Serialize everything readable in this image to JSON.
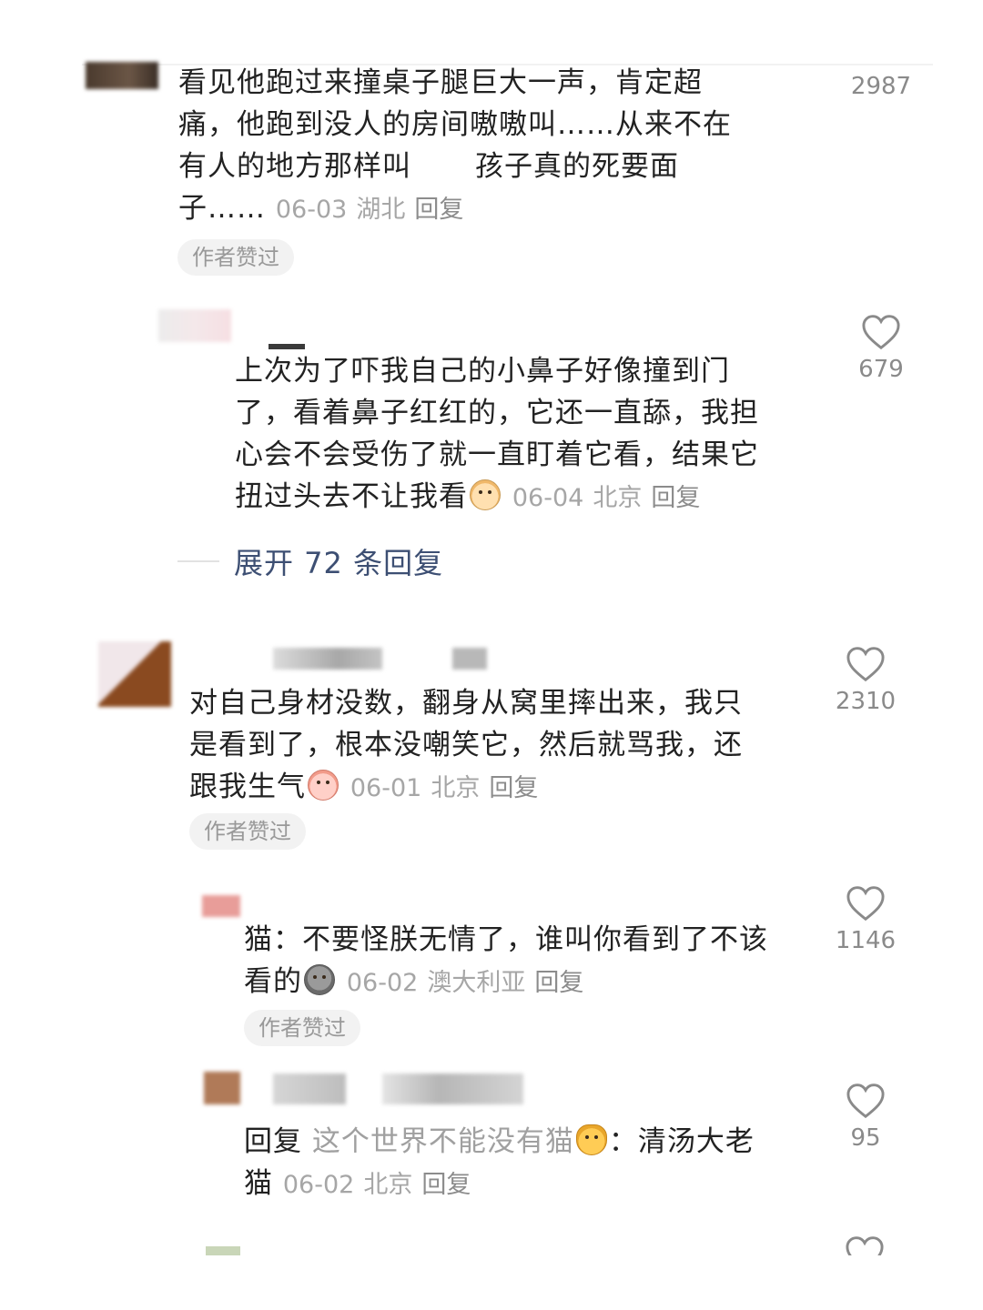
{
  "comments": [
    {
      "text": "看见他跑过来撞桌子腿巨大一声，肯定超痛，他跑到没人的房间嗷嗷叫……从来不在有人的地方那样叫",
      "text_line1": "看见他跑过来撞桌子腿巨大一声，肯定超",
      "text_line2": "痛，他跑到没人的房间嗷嗷叫……从来不在",
      "text_line3a": "有人的地方那样叫",
      "text_line3b": "孩子真的死要面",
      "text_line4": "子……",
      "date": "06-03",
      "region": "湖北",
      "reply_label": "回复",
      "likes": "2987",
      "author_liked": "作者赞过"
    },
    {
      "text_line1": "上次为了吓我自己的小鼻子好像撞到门",
      "text_line2": "了，看着鼻子红红的，它还一直舔，我担",
      "text_line3": "心会不会受伤了就一直盯着它看，结果它",
      "text_line4": "扭过头去不让我看",
      "emoji": "crying-face-emoji",
      "date": "06-04",
      "region": "北京",
      "reply_label": "回复",
      "likes": "679"
    },
    {
      "text_line1": "对自己身材没数，翻身从窝里摔出来，我只",
      "text_line2": "是看到了，根本没嘲笑它，然后就骂我，还",
      "text_line3": "跟我生气",
      "emoji": "angry-face-emoji",
      "date": "06-01",
      "region": "北京",
      "reply_label": "回复",
      "likes": "2310",
      "author_liked": "作者赞过"
    },
    {
      "text_line1": "猫：不要怪朕无情了，谁叫你看到了不该",
      "text_line2": "看的",
      "emoji": "skull-emoji",
      "date": "06-02",
      "region": "澳大利亚",
      "reply_label": "回复",
      "likes": "1146",
      "author_liked": "作者赞过"
    },
    {
      "prefix": "回复",
      "reply_to": "这个世界不能没有猫",
      "emoji": "cat-face-emoji",
      "colon": "：",
      "text_line1_rest": "清汤大老",
      "text_line2": "猫",
      "date": "06-02",
      "region": "北京",
      "reply_label": "回复",
      "likes": "95"
    }
  ],
  "expand_replies": "展开 72 条回复",
  "colors": {
    "text": "#222222",
    "meta": "#a6a6a6",
    "link": "#3d4f73",
    "badge_bg": "#f2f2f2"
  }
}
